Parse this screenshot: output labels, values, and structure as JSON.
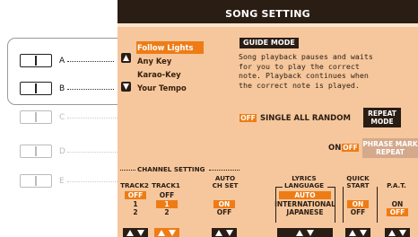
{
  "screen": {
    "title": "SONG SETTING",
    "guide_mode": {
      "options": [
        "Follow Lights",
        "Any Key",
        "Karao-Key",
        "Your Tempo"
      ],
      "selected": "Follow Lights",
      "header": "GUIDE MODE",
      "description": [
        "Song playback pauses and waits",
        "for you to play the correct",
        "note. Playback continues when",
        "the correct note is played."
      ]
    },
    "repeat": {
      "state": "OFF",
      "options_label": "SINGLE ALL RANDOM",
      "button": [
        "REPEAT",
        "MODE"
      ]
    },
    "phrase_mark": {
      "on": "ON",
      "off": "OFF",
      "button": [
        "PHRASE MARK",
        "REPEAT"
      ]
    },
    "channel_setting": {
      "title": "CHANNEL SETTING",
      "columns": [
        {
          "header": [
            "",
            "TRACK2"
          ],
          "values": [
            "OFF",
            "1",
            "2"
          ],
          "selected": "OFF"
        },
        {
          "header": [
            "",
            "TRACK1"
          ],
          "values": [
            "OFF",
            "1",
            "2"
          ],
          "selected": "1"
        },
        {
          "header": [
            "AUTO",
            "CH SET"
          ],
          "values": [
            "ON",
            "OFF"
          ],
          "selected": "ON"
        }
      ]
    },
    "lyrics_language": {
      "header": [
        "LYRICS",
        "LANGUAGE"
      ],
      "values": [
        "AUTO",
        "INTERNATIONAL",
        "JAPANESE"
      ],
      "selected": "AUTO"
    },
    "quick_start": {
      "header": [
        "QUICK",
        "START"
      ],
      "values": [
        "ON",
        "OFF"
      ],
      "selected": "ON"
    },
    "pat": {
      "header": "P.A.T.",
      "values": [
        "ON",
        "OFF"
      ],
      "selected": "OFF"
    }
  },
  "side_buttons": [
    {
      "label": "A"
    },
    {
      "label": "B"
    },
    {
      "label": "C"
    },
    {
      "label": "D"
    },
    {
      "label": "E"
    }
  ],
  "colors": {
    "screen_bg": "#f6c79c",
    "accent": "#ee7c16",
    "dark": "#2a1d14"
  },
  "icons": {
    "up": "triangle-up-icon",
    "down": "triangle-down-icon"
  }
}
